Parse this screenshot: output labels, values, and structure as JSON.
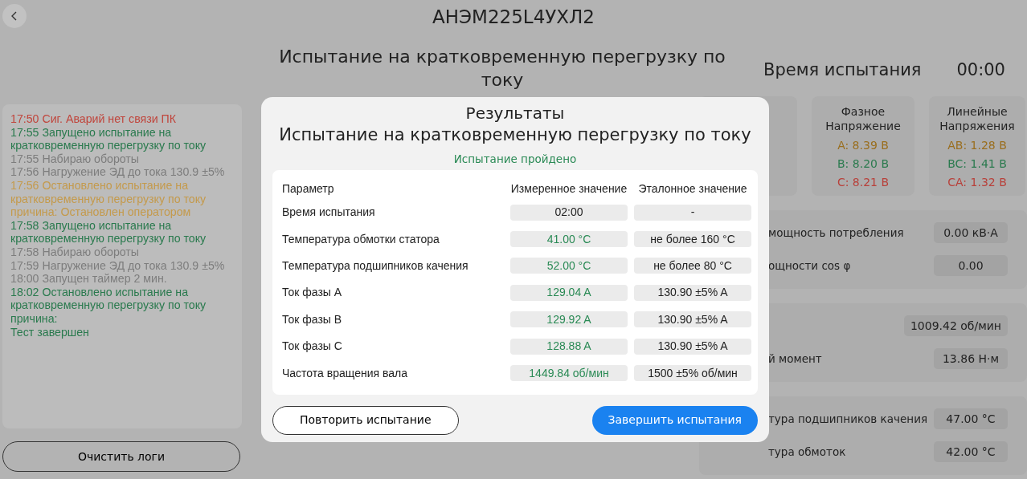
{
  "header": {
    "title": "АНЭМ225L4УХЛ2"
  },
  "test_title": "Испытание на кратковременную перегрузку по току",
  "timer": {
    "label": "Время испытания",
    "value": "00:00"
  },
  "log": [
    {
      "text": "17:50 Сиг. Аварий нет связи ПК",
      "color": "#c0453c"
    },
    {
      "text": "17:55 Запущено испытание на\nкратковременную перегрузку по току",
      "color": "#2a7a4e"
    },
    {
      "text": "17:55 Набираю обороты",
      "color": "#7d7d7d"
    },
    {
      "text": "17:56 Нагружение ЭД до тока 130.9 ±5%",
      "color": "#7d7d7d"
    },
    {
      "text": "17:56 Остановлено испытание на\nкратковременную перегрузку по току\nпричина: Остановлен оператором",
      "color": "#c49a4c"
    },
    {
      "text": "17:58 Запущено испытание на\nкратковременную перегрузку по току",
      "color": "#2a7a4e"
    },
    {
      "text": "17:58 Набираю обороты",
      "color": "#7d7d7d"
    },
    {
      "text": "17:59 Нагружение ЭД до тока 130.9 ±5%",
      "color": "#7d7d7d"
    },
    {
      "text": "18:00 Запущен таймер 2 мин.",
      "color": "#7d7d7d"
    },
    {
      "text": "18:02 Остановлено испытание на\nкратковременную перегрузку по току\nпричина:\nТест завершен",
      "color": "#2a7a4e"
    }
  ],
  "clear_button": "Очистить логи",
  "cards": [
    {
      "title": "Фазное\nНапряжение",
      "values": [
        {
          "text": "A: 8.39 B",
          "color": "#9a6e1e"
        },
        {
          "text": "B: 8.20 B",
          "color": "#2a7a4e"
        },
        {
          "text": "C: 8.21 B",
          "color": "#b8403a"
        }
      ]
    },
    {
      "title": "Линейные\nНапряжения",
      "values": [
        {
          "text": "AB: 1.28 B",
          "color": "#9a6e1e"
        },
        {
          "text": "BC: 1.41 B",
          "color": "#2a7a4e"
        },
        {
          "text": "CA: 1.32 B",
          "color": "#b8403a"
        }
      ]
    }
  ],
  "panels": [
    {
      "rows": [
        {
          "label": "мощность потребления",
          "value": "0.00 кВ·А"
        },
        {
          "label": "ощности cos φ",
          "value": "0.00"
        }
      ]
    },
    {
      "rows": [
        {
          "value": "1009.42 об/мин"
        },
        {
          "label": "й момент",
          "value": "13.86 Н·м"
        }
      ]
    },
    {
      "rows": [
        {
          "label": "тура подшипников качения",
          "value": "47.00 °C"
        },
        {
          "label": "тура обмоток",
          "value": "42.00 °C"
        }
      ]
    }
  ],
  "dialog": {
    "title": "Результаты",
    "subtitle": "Испытание на кратковременную перегрузку по току",
    "status": "Испытание пройдено",
    "columns": [
      "Параметр",
      "Измеренное значение",
      "Эталонное значение"
    ],
    "rows": [
      {
        "parameter": "Время испытания",
        "measured": "02:00",
        "color": "#222222",
        "reference": "-"
      },
      {
        "parameter": "Температура обмотки статора",
        "measured": "41.00 °C",
        "color": "#2a8a55",
        "reference": "не более 160 °C"
      },
      {
        "parameter": "Температура подшипников качения",
        "measured": "52.00 °C",
        "color": "#2a8a55",
        "reference": "не более 80 °C"
      },
      {
        "parameter": "Ток фазы A",
        "measured": "129.04 A",
        "color": "#2a8a55",
        "reference": "130.90 ±5% A"
      },
      {
        "parameter": "Ток фазы B",
        "measured": "129.92 A",
        "color": "#2a8a55",
        "reference": "130.90 ±5% A"
      },
      {
        "parameter": "Ток фазы C",
        "measured": "128.88 A",
        "color": "#2a8a55",
        "reference": "130.90 ±5% A"
      },
      {
        "parameter": "Частота вращения вала",
        "measured": "1449.84 об/мин",
        "color": "#2a8a55",
        "reference": "1500 ±5% об/мин"
      }
    ],
    "buttons": [
      {
        "label": "Повторить испытание",
        "kind": "outline"
      },
      {
        "label": "Завершить испытания",
        "kind": "primary"
      }
    ]
  }
}
